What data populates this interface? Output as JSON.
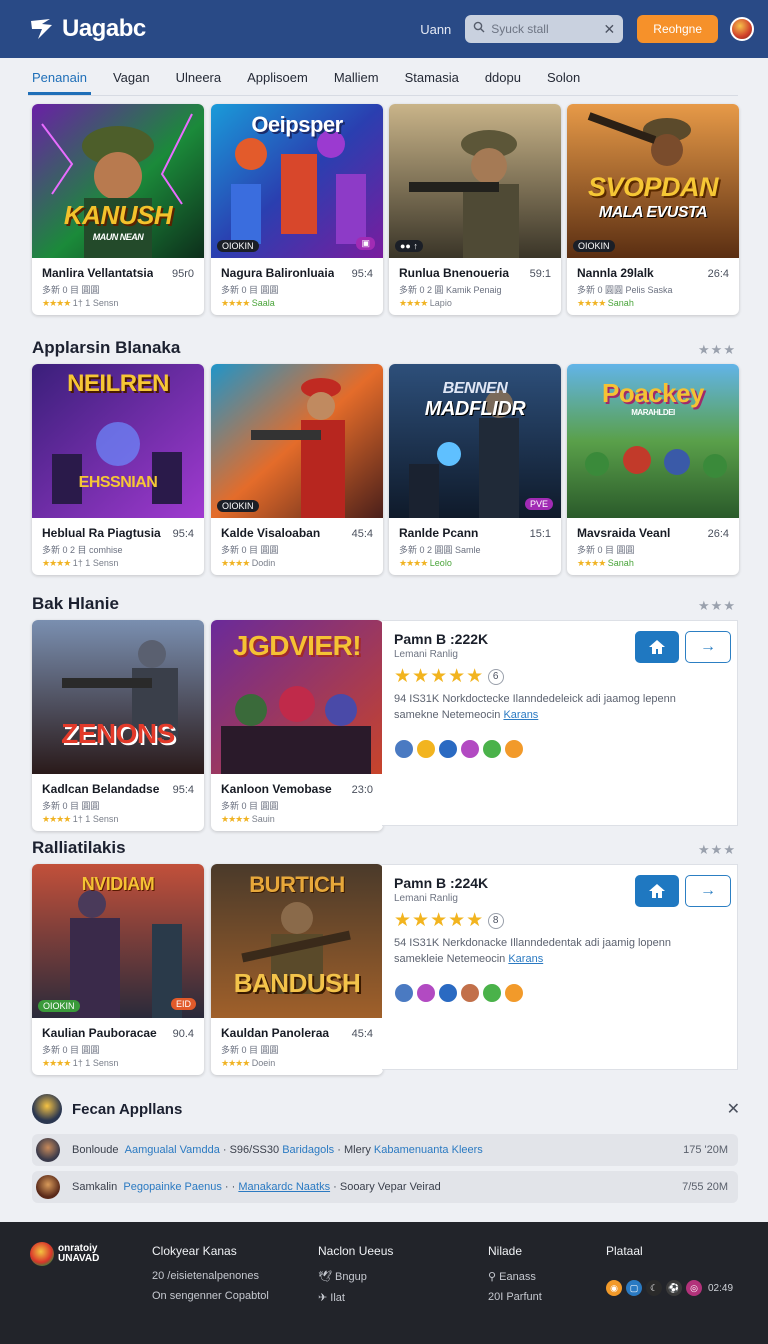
{
  "header": {
    "brand": "Uagabc",
    "user_label": "Uann",
    "search_placeholder": "Syuck stall",
    "signin_label": "Reohgne"
  },
  "tabs": [
    {
      "label": "Penanain",
      "active": true
    },
    {
      "label": "Vagan"
    },
    {
      "label": "Ulneera"
    },
    {
      "label": "Applisoem"
    },
    {
      "label": "Malliem"
    },
    {
      "label": "Stamasia"
    },
    {
      "label": "ddopu"
    },
    {
      "label": "Solon"
    }
  ],
  "row1": [
    {
      "art_title": "KANUSH",
      "art_sub": "MAUN NEAN",
      "name": "Manlira Vellantatsia",
      "score": "95r0",
      "meta": "多新 0 目 圓圓",
      "rating_text": "1† 1 Sensn",
      "badge": ""
    },
    {
      "art_title": "Oeipsper",
      "art_sub": "",
      "name": "Nagura Balironluaia",
      "score": "95:4",
      "meta": "多新 0 目 圓圓",
      "rating_text": "Saala",
      "badge": "OIOKIN"
    },
    {
      "art_title": "",
      "art_sub": "",
      "name": "Runlua Bnenoueria",
      "score": "59:1",
      "meta": "多新 0 2 圓 Kamik Penaig",
      "rating_text": "Lapio",
      "badge": "●● ↑"
    },
    {
      "art_title": "SVOPDAN",
      "art_sub": "MALA EVUSTA",
      "name": "Nannla 29lalk",
      "score": "26:4",
      "meta": "多新 0 圓圓 Pelis Saska",
      "rating_text": "Sanah",
      "badge": "OIOKIN"
    }
  ],
  "section2": {
    "title": "Applarsin Blanaka",
    "dots": "★★★"
  },
  "row2": [
    {
      "art_title": "NEILREN",
      "art_sub": "EHSSNIAN",
      "name": "Heblual Ra Piagtusia",
      "score": "95:4",
      "meta": "多新 0 2 目 comhise",
      "rating_text": "1† 1 Sensn",
      "badge": ""
    },
    {
      "art_title": "",
      "art_sub": "",
      "name": "Kalde Visaloaban",
      "score": "45:4",
      "meta": "多新 0 目 圓圓",
      "rating_text": "Dodin",
      "badge": "OIOKIN"
    },
    {
      "art_title": "BENNEN",
      "art_sub": "MADFLIDR",
      "name": "Ranlde Pcann",
      "score": "15:1",
      "meta": "多新 0 2 圓圓 Samle",
      "rating_text": "Leolo",
      "badge": "PVE"
    },
    {
      "art_title": "Poackey",
      "art_sub": "MARAHLDEI",
      "name": "Mavsraida Veanl",
      "score": "26:4",
      "meta": "多新 0 目 圓圓",
      "rating_text": "Sanah",
      "badge": ""
    }
  ],
  "section3": {
    "title": "Bak Hlanie",
    "dots": "★★★"
  },
  "row3": [
    {
      "art_title": "ZENONS",
      "art_sub": "",
      "name": "Kadlcan Belandadse",
      "score": "95:4",
      "meta": "多新 0 目 圓圓",
      "rating_text": "1† 1 Sensn"
    },
    {
      "art_title": "JGDVIER!",
      "art_sub": "",
      "name": "Kanloon Vemobase",
      "score": "23:0",
      "meta": "多新 0 目 圓圓",
      "rating_text": "Sauin"
    }
  ],
  "detail1": {
    "title": "Pamn B :222K",
    "subtitle": "Lemani Ranlig",
    "stars": "★★★★★",
    "count": "6",
    "desc": "94 IS31K Norkdoctecke Ilanndedeleick adi jaamog lepenn samekne Netemeocin",
    "link": "Karans"
  },
  "section4": {
    "title": "Ralliatilakis",
    "dots": "★★★"
  },
  "row4": [
    {
      "art_title": "NVIDIAM",
      "art_sub": "",
      "name": "Kaulian Pauboracae",
      "score": "90.4",
      "meta": "多新 0 目 圓圓",
      "rating_text": "1† 1 Sensn",
      "badge": "OIOKIN",
      "badge2": "EID"
    },
    {
      "art_title": "BURTICH",
      "art_sub": "BANDUSH",
      "name": "Kauldan Panoleraa",
      "score": "45:4",
      "meta": "多新 0 目 圓圓",
      "rating_text": "Doein"
    }
  ],
  "detail2": {
    "title": "Pamn B :224K",
    "subtitle": "Lemani Ranlig",
    "stars": "★★★★★",
    "count": "8",
    "desc": "54 IS31K Nerkdonacke Illanndedentak adi jaamig lopenn samekleie Netemeocin",
    "link": "Karans"
  },
  "feed": {
    "title": "Fecan Appllans",
    "rows": [
      {
        "a": "Bonloude",
        "b": "Aamgualal Vamdda",
        "c": "· S96/SS30",
        "d": "Baridagols",
        "e": "· Mlery",
        "f": "Kabamenuanta",
        "g": "Kleers",
        "time": "175 '20M"
      },
      {
        "a": "Samkalin",
        "b": "Pegopainke Paenus",
        "c": "· ·",
        "d": "Manakardc Naatks",
        "e": "· Sooary Vepar Veirad",
        "f": "",
        "g": "",
        "time": "7/55 20M"
      }
    ]
  },
  "footer": {
    "brand_top": "onratoiy",
    "brand_bottom": "UNAVAD",
    "col1": {
      "head": "Clokyear Kanas",
      "items": [
        "20 /eisietenalpenones",
        "On sengenner Copabtol"
      ]
    },
    "col2": {
      "head": "Naclon Ueeus",
      "items": [
        "Bngup",
        "Ilat"
      ]
    },
    "col3": {
      "head": "Nilade",
      "items": [
        "Eanass",
        "20I Parfunt"
      ]
    },
    "col4": {
      "head": "Plataal",
      "count": "02:49"
    }
  },
  "colors": {
    "header_bg": "#294a86",
    "accent_orange": "#f6912a",
    "link_blue": "#2b7ac2",
    "star": "#f0b323",
    "footer_bg": "#22242a"
  }
}
